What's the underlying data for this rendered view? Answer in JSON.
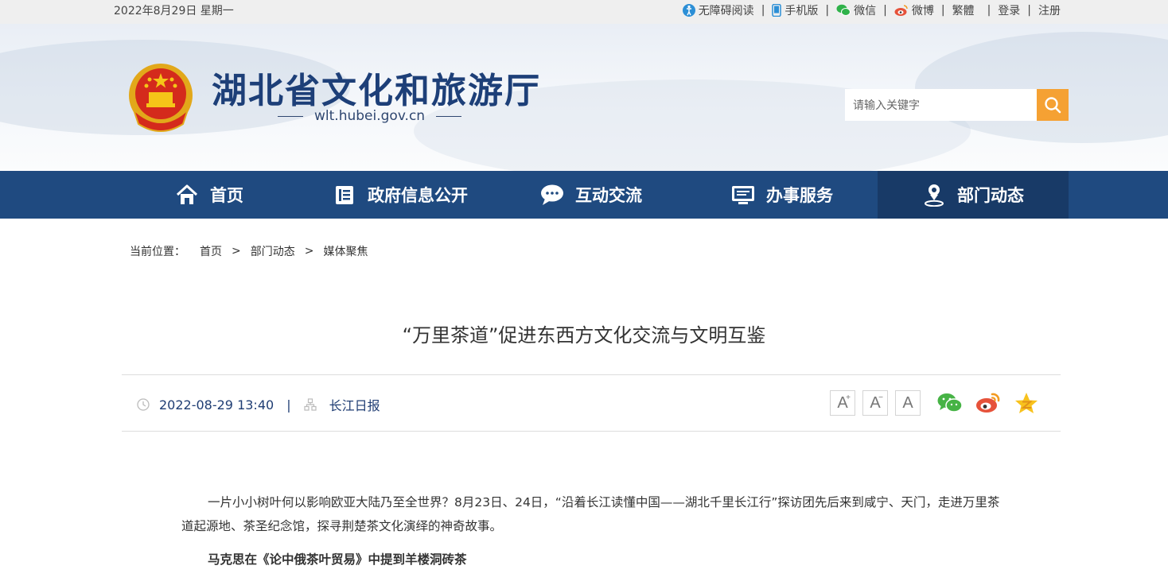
{
  "topbar": {
    "date": "2022年8月29日 星期一",
    "links": [
      {
        "label": "无障碍阅读",
        "icon": "accessibility-icon"
      },
      {
        "label": "手机版",
        "icon": "mobile-phone-icon"
      },
      {
        "label": "微信",
        "icon": "wechat-icon"
      },
      {
        "label": "微博",
        "icon": "weibo-icon"
      },
      {
        "label": "繁體",
        "icon": ""
      },
      {
        "label": "登录",
        "icon": ""
      },
      {
        "label": "注册",
        "icon": ""
      }
    ]
  },
  "header": {
    "site_name": "湖北省文化和旅游厅",
    "site_url": "wlt.hubei.gov.cn",
    "search_placeholder": "请输入关键字"
  },
  "nav": {
    "items": [
      {
        "label": "首页",
        "icon": "home-icon"
      },
      {
        "label": "政府信息公开",
        "icon": "document-list-icon"
      },
      {
        "label": "互动交流",
        "icon": "chat-bubble-icon"
      },
      {
        "label": "办事服务",
        "icon": "monitor-icon"
      },
      {
        "label": "部门动态",
        "icon": "location-person-icon"
      }
    ],
    "active_index": 4
  },
  "breadcrumb": {
    "lead": "当前位置：",
    "items": [
      "首页",
      "部门动态",
      "媒体聚焦"
    ],
    "separator": ">"
  },
  "article": {
    "title": "“万里茶道”促进东西方文化交流与文明互鉴",
    "datetime": "2022-08-29 13:40",
    "source": "长江日报",
    "font_buttons": [
      "A+",
      "A-",
      "A"
    ],
    "share_icons": [
      "wechat-share-icon",
      "weibo-share-icon",
      "qzone-share-icon"
    ],
    "paragraph_1": "一片小小树叶何以影响欧亚大陆乃至全世界？8月23日、24日，“沿着长江读懂中国——湖北千里长江行”探访团先后来到咸宁、天门，走进万里茶道起源地、茶圣纪念馆，探寻荆楚茶文化演绎的神奇故事。",
    "subheading": "马克思在《论中俄茶叶贸易》中提到羊楼洞砖茶"
  },
  "colors": {
    "nav_bg": "#1f4a80",
    "nav_active_bg": "#183a67",
    "search_button": "#f5a133",
    "site_name": "#1d3f78",
    "meta_text": "#1f3d73"
  }
}
